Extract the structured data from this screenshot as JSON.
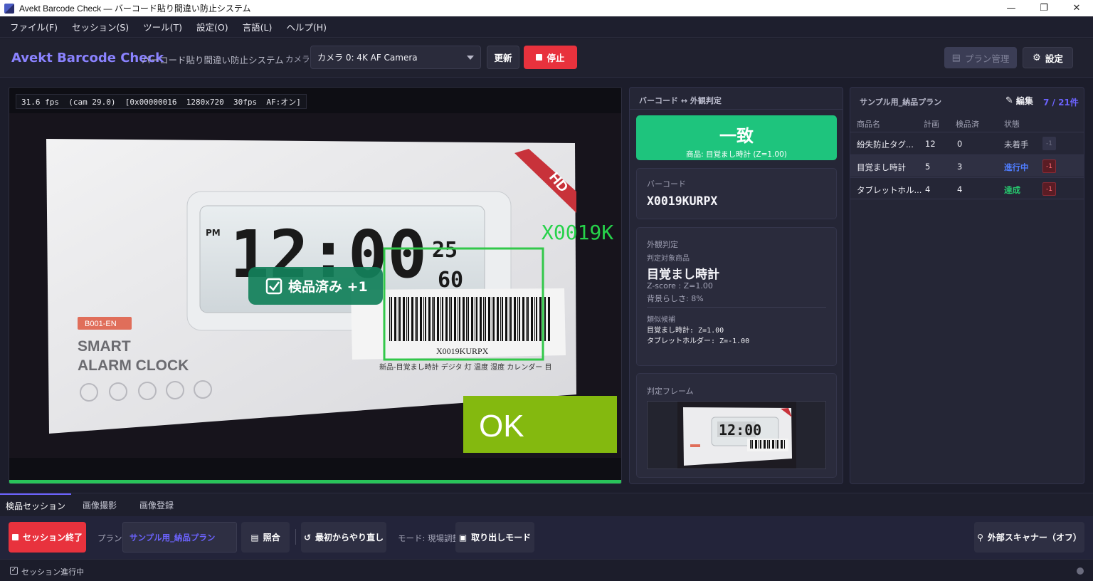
{
  "window": {
    "title": "Avekt Barcode Check — バーコード貼り間違い防止システム",
    "controls": [
      "—",
      "❐",
      "✕"
    ]
  },
  "menu": [
    "ファイル(F)",
    "セッション(S)",
    "ツール(T)",
    "設定(O)",
    "言語(L)",
    "ヘルプ(H)"
  ],
  "header": {
    "brand": "Avekt Barcode Check",
    "subtitle": "バーコード貼り間違い防止システム",
    "camera_label": "カメラ:",
    "camera_value": "カメラ 0:  4K AF Camera",
    "refresh": "更新",
    "stop": "停止",
    "plan_manage": "プラン管理",
    "settings": "設定"
  },
  "camera": {
    "fps_line": "31.6 fps  (cam 29.0)  [0x00000016  1280x720  30fps  AF:オン]",
    "overlay_barcode": "X0019K",
    "inspected_badge": "検品済み  +1",
    "ok_label": "OK",
    "box_code": "B001-EN",
    "box_line1": "SMART",
    "box_line2": "ALARM CLOCK",
    "lcd_time": "12:00",
    "lcd_pm": "PM",
    "lcd_temp": "25",
    "lcd_hum": "60",
    "hd": "HD",
    "label_code": "X0019KURPX",
    "label_text": "新品-目覚まし時計 デジタ 灯 温度 湿度 カレンダー 目"
  },
  "judgement": {
    "header": "バーコード ↔ 外観判定",
    "result": "一致",
    "result_sub": "商品: 目覚まし時計 (Z=1.00)",
    "barcode_label": "バーコード",
    "barcode_value": "X0019KURPX",
    "appearance_label": "外観判定",
    "target_label": "判定対象商品",
    "target_name": "目覚まし時計",
    "zscore": "Z-score : Z=1.00",
    "background": "背景らしさ: 8%",
    "similar_label": "類似候補",
    "similar": [
      "目覚まし時計: Z=1.00",
      "タブレットホルダー: Z=-1.00"
    ],
    "frame_label": "判定フレーム"
  },
  "plan": {
    "title": "サンプル用_納品プラン",
    "edit": "編集",
    "count": "7 / 21件",
    "columns": [
      "商品名",
      "計画",
      "検品済",
      "状態"
    ],
    "rows": [
      {
        "name": "紛失防止タグ...",
        "plan": "12",
        "done": "0",
        "status": "未着手",
        "action": "-1"
      },
      {
        "name": "目覚まし時計",
        "plan": "5",
        "done": "3",
        "status": "進行中",
        "action": "-1"
      },
      {
        "name": "タブレットホル...",
        "plan": "4",
        "done": "4",
        "status": "達成",
        "action": "-1"
      }
    ]
  },
  "tabs": [
    "検品セッション",
    "画像撮影",
    "画像登録"
  ],
  "actions": {
    "end_session": "セッション終了",
    "plan_label": "プラン:",
    "plan_value": "サンプル用_納品プラン",
    "verify": "照合",
    "retry": "最初からやり直し",
    "mode_label": "モード: 現場調整",
    "pickup_mode": "取り出しモード",
    "external_scanner": "外部スキャナー（オフ）"
  },
  "status": {
    "text": "セッション進行中"
  }
}
